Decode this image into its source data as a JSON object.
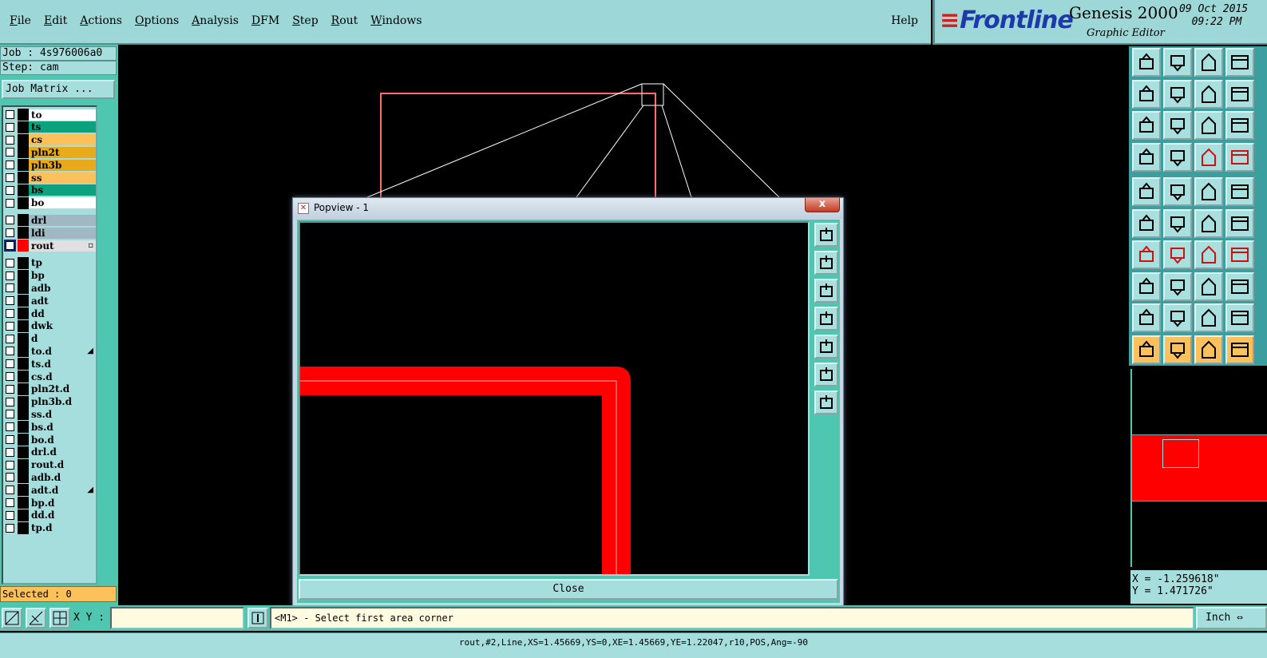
{
  "menu": {
    "items": [
      {
        "label": "File"
      },
      {
        "label": "Edit"
      },
      {
        "label": "Actions"
      },
      {
        "label": "Options"
      },
      {
        "label": "Analysis"
      },
      {
        "label": "DFM"
      },
      {
        "label": "Step"
      },
      {
        "label": "Rout"
      },
      {
        "label": "Windows"
      }
    ],
    "help": "Help"
  },
  "brand": {
    "logo": "Frontline",
    "product": "Genesis 2000",
    "subtitle": "Graphic Editor",
    "date": "09 Oct 2015",
    "time": "09:22 PM"
  },
  "job": {
    "job_line": "Job : 4s976006a0",
    "step_line": "Step: cam",
    "matrix_button": "Job Matrix ..."
  },
  "layers": [
    {
      "name": "to",
      "color": "#ffffff"
    },
    {
      "name": "ts",
      "color": "#0aa37e"
    },
    {
      "name": "cs",
      "color": "#fdc15b"
    },
    {
      "name": "pln2t",
      "color": "#e8a91a"
    },
    {
      "name": "pln3b",
      "color": "#e8a91a"
    },
    {
      "name": "ss",
      "color": "#fdc15b"
    },
    {
      "name": "bs",
      "color": "#0aa37e"
    },
    {
      "name": "bo",
      "color": "#ffffff"
    },
    {
      "name": "drl",
      "color": "#a1b7c1"
    },
    {
      "name": "ldi",
      "color": "#a1b7c1"
    },
    {
      "name": "rout",
      "color": "#e0e0e0",
      "swatch": "#ff0000",
      "active": true
    },
    {
      "name": "tp",
      "color": "#a6dede"
    },
    {
      "name": "bp",
      "color": "#a6dede"
    },
    {
      "name": "adb",
      "color": "#a6dede"
    },
    {
      "name": "adt",
      "color": "#a6dede"
    },
    {
      "name": "dd",
      "color": "#a6dede"
    },
    {
      "name": "dwk",
      "color": "#a6dede"
    },
    {
      "name": "d",
      "color": "#a6dede"
    },
    {
      "name": "to.d",
      "color": "#a6dede",
      "mark": true
    },
    {
      "name": "ts.d",
      "color": "#a6dede"
    },
    {
      "name": "cs.d",
      "color": "#a6dede"
    },
    {
      "name": "pln2t.d",
      "color": "#a6dede"
    },
    {
      "name": "pln3b.d",
      "color": "#a6dede"
    },
    {
      "name": "ss.d",
      "color": "#a6dede"
    },
    {
      "name": "bs.d",
      "color": "#a6dede"
    },
    {
      "name": "bo.d",
      "color": "#a6dede"
    },
    {
      "name": "drl.d",
      "color": "#a6dede"
    },
    {
      "name": "rout.d",
      "color": "#a6dede"
    },
    {
      "name": "adb.d",
      "color": "#a6dede"
    },
    {
      "name": "adt.d",
      "color": "#a6dede",
      "mark": true
    },
    {
      "name": "bp.d",
      "color": "#a6dede"
    },
    {
      "name": "dd.d",
      "color": "#a6dede"
    },
    {
      "name": "tp.d",
      "color": "#a6dede"
    }
  ],
  "selected": "Selected : 0",
  "popview": {
    "title": "Popview - 1",
    "close_x": "x",
    "close_button": "Close"
  },
  "coords": {
    "x": "X = -1.259618\"",
    "y": "Y = 1.471726\""
  },
  "bottom": {
    "xy_label": "X Y :",
    "xy_value": "",
    "prompt": "<M1> - Select first area corner",
    "units": "Inch"
  },
  "status": "rout,#2,Line,XS=1.45669,YS=0,XE=1.45669,YE=1.22047,r10,POS,Ang=-90",
  "colors": {
    "panel": "#4fc7b0",
    "panel_light": "#a6dede",
    "highlight": "#fdc15b",
    "feature": "#ff0000"
  }
}
